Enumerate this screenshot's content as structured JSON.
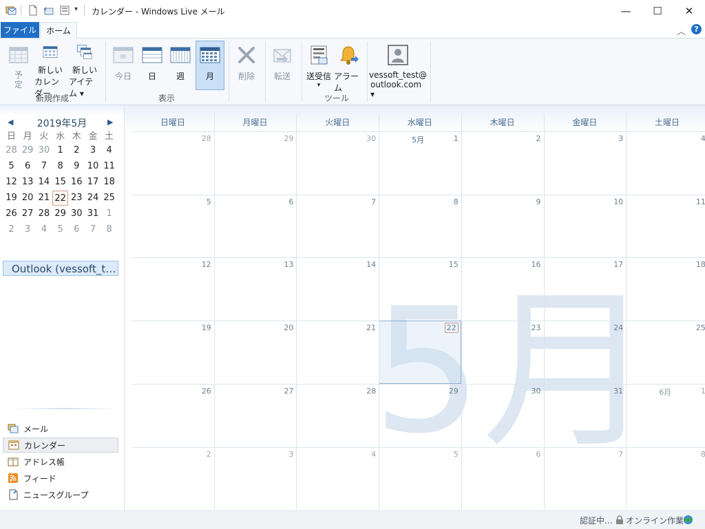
{
  "window": {
    "title": "カレンダー - Windows Live メール",
    "controls": {
      "minimize": "—",
      "maximize": "☐",
      "close": "✕"
    }
  },
  "quick_access": [
    {
      "icon": "mail-app-icon"
    },
    {
      "icon": "new-document-icon"
    },
    {
      "icon": "reply-icon"
    },
    {
      "icon": "send-receive-icon"
    },
    {
      "icon": "customize-dropdown-icon"
    }
  ],
  "tabs": {
    "file": "ファイル",
    "home": "ホーム"
  },
  "ribbon": {
    "groups": {
      "new": "新規作成",
      "view": "表示",
      "tools": "ツール"
    },
    "buttons": {
      "event": "予定",
      "new_calendar_line1": "新しい",
      "new_calendar_line2": "カレンダー",
      "new_item_line1": "新しい",
      "new_item_line2": "アイテム ▾",
      "today": "今日",
      "day": "日",
      "week": "週",
      "month": "月",
      "delete": "削除",
      "forward": "転送",
      "send_receive": "送受信",
      "send_receive_arrow": "▾",
      "alarm": "アラーム",
      "account_line1": "vessoft_test@",
      "account_line2": "outlook.com ▾"
    },
    "collapse": "︿",
    "help": "?"
  },
  "mini_calendar": {
    "title": "2019年5月",
    "prev": "◀",
    "next": "▶",
    "weekdays": [
      "日",
      "月",
      "火",
      "水",
      "木",
      "金",
      "土"
    ],
    "weeks": [
      [
        {
          "d": "28",
          "o": true
        },
        {
          "d": "29",
          "o": true
        },
        {
          "d": "30",
          "o": true
        },
        {
          "d": "1"
        },
        {
          "d": "2"
        },
        {
          "d": "3"
        },
        {
          "d": "4"
        }
      ],
      [
        {
          "d": "5"
        },
        {
          "d": "6"
        },
        {
          "d": "7"
        },
        {
          "d": "8"
        },
        {
          "d": "9"
        },
        {
          "d": "10"
        },
        {
          "d": "11"
        }
      ],
      [
        {
          "d": "12"
        },
        {
          "d": "13"
        },
        {
          "d": "14"
        },
        {
          "d": "15"
        },
        {
          "d": "16"
        },
        {
          "d": "17"
        },
        {
          "d": "18"
        }
      ],
      [
        {
          "d": "19"
        },
        {
          "d": "20"
        },
        {
          "d": "21"
        },
        {
          "d": "22",
          "t": true
        },
        {
          "d": "23"
        },
        {
          "d": "24"
        },
        {
          "d": "25"
        }
      ],
      [
        {
          "d": "26"
        },
        {
          "d": "27"
        },
        {
          "d": "28"
        },
        {
          "d": "29"
        },
        {
          "d": "30"
        },
        {
          "d": "31"
        },
        {
          "d": "1",
          "o": true
        }
      ],
      [
        {
          "d": "2",
          "o": true
        },
        {
          "d": "3",
          "o": true
        },
        {
          "d": "4",
          "o": true
        },
        {
          "d": "5",
          "o": true
        },
        {
          "d": "6",
          "o": true
        },
        {
          "d": "7",
          "o": true
        },
        {
          "d": "8",
          "o": true
        }
      ]
    ]
  },
  "calendar_list": {
    "item": "Outlook (vessoft_t…"
  },
  "nav": [
    {
      "label": "メール",
      "icon": "mail-icon",
      "selected": false
    },
    {
      "label": "カレンダー",
      "icon": "calendar-icon",
      "selected": true
    },
    {
      "label": "アドレス帳",
      "icon": "address-book-icon",
      "selected": false
    },
    {
      "label": "フィード",
      "icon": "rss-feed-icon",
      "selected": false
    },
    {
      "label": "ニュースグループ",
      "icon": "newsgroup-icon",
      "selected": false
    }
  ],
  "month_view": {
    "weekdays": [
      "日曜日",
      "月曜日",
      "火曜日",
      "水曜日",
      "木曜日",
      "金曜日",
      "土曜日"
    ],
    "watermark": "5月",
    "weeks": [
      [
        {
          "d": "28",
          "o": true
        },
        {
          "d": "29",
          "o": true
        },
        {
          "d": "30",
          "o": true
        },
        {
          "d": "1",
          "m": "5月"
        },
        {
          "d": "2"
        },
        {
          "d": "3"
        },
        {
          "d": "4"
        }
      ],
      [
        {
          "d": "5"
        },
        {
          "d": "6"
        },
        {
          "d": "7"
        },
        {
          "d": "8"
        },
        {
          "d": "9"
        },
        {
          "d": "10"
        },
        {
          "d": "11"
        }
      ],
      [
        {
          "d": "12"
        },
        {
          "d": "13"
        },
        {
          "d": "14"
        },
        {
          "d": "15"
        },
        {
          "d": "16"
        },
        {
          "d": "17"
        },
        {
          "d": "18"
        }
      ],
      [
        {
          "d": "19"
        },
        {
          "d": "20"
        },
        {
          "d": "21"
        },
        {
          "d": "22",
          "t": true
        },
        {
          "d": "23"
        },
        {
          "d": "24"
        },
        {
          "d": "25"
        }
      ],
      [
        {
          "d": "26"
        },
        {
          "d": "27"
        },
        {
          "d": "28"
        },
        {
          "d": "29"
        },
        {
          "d": "30"
        },
        {
          "d": "31"
        },
        {
          "d": "1",
          "o": true,
          "m": "6月"
        }
      ],
      [
        {
          "d": "2",
          "o": true
        },
        {
          "d": "3",
          "o": true
        },
        {
          "d": "4",
          "o": true
        },
        {
          "d": "5",
          "o": true
        },
        {
          "d": "6",
          "o": true
        },
        {
          "d": "7",
          "o": true
        },
        {
          "d": "8",
          "o": true
        }
      ]
    ]
  },
  "status": {
    "auth": "認証中...",
    "online": "オンライン作業中"
  },
  "colors": {
    "accent": "#1f6fc5",
    "today_border": "#d09a8a",
    "grid_line": "#dbe4ee"
  }
}
